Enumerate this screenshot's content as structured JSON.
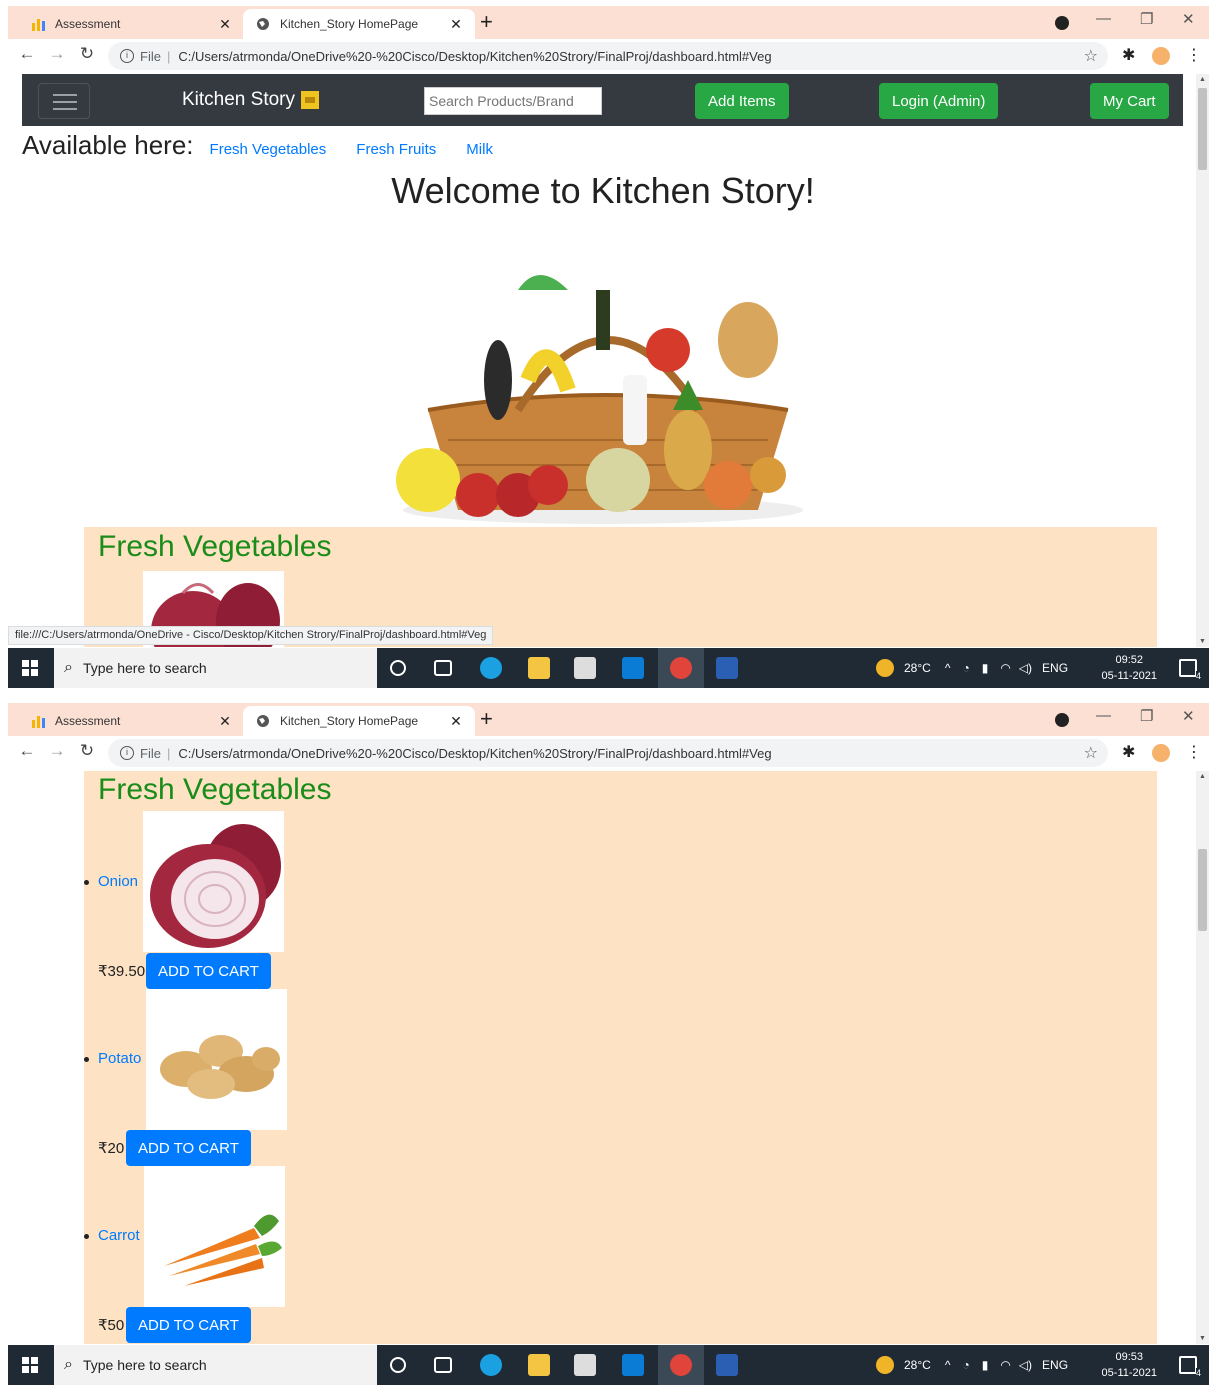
{
  "browser": {
    "tabs": [
      {
        "title": "Assessment",
        "active": false
      },
      {
        "title": "Kitchen_Story HomePage",
        "active": true
      }
    ],
    "new_tab": "+",
    "file_label": "File",
    "url": "C:/Users/atrmonda/OneDrive%20-%20Cisco/Desktop/Kitchen%20Strory/FinalProj/dashboard.html#Veg",
    "status_url": "file:///C:/Users/atrmonda/OneDrive - Cisco/Desktop/Kitchen Strory/FinalProj/dashboard.html#Veg"
  },
  "navbar": {
    "brand": "Kitchen Story",
    "search_placeholder": "Search Products/Brand",
    "add_items": "Add Items",
    "login": "Login (Admin)",
    "cart": "My Cart"
  },
  "available": {
    "label": "Available here:",
    "links": [
      "Fresh Vegetables",
      "Fresh Fruits",
      "Milk"
    ]
  },
  "welcome": "Welcome to Kitchen Story!",
  "section": {
    "title": "Fresh Vegetables",
    "products": [
      {
        "name": "Onion",
        "price": "₹39.50",
        "button": "ADD TO CART"
      },
      {
        "name": "Potato",
        "price": "₹20",
        "button": "ADD TO CART"
      },
      {
        "name": "Carrot",
        "price": "₹50",
        "button": "ADD TO CART"
      }
    ]
  },
  "taskbar": {
    "search_placeholder": "Type here to search",
    "weather": "28°C",
    "lang": "ENG",
    "date": "05-11-2021",
    "time_first": "09:52",
    "time_second": "09:53",
    "notification_count": "4"
  },
  "colors": {
    "navbar_bg": "#343a40",
    "green_button": "#28a745",
    "blue_button": "#007bff",
    "section_bg": "#fde2c4",
    "section_title": "#1a8c1a"
  }
}
